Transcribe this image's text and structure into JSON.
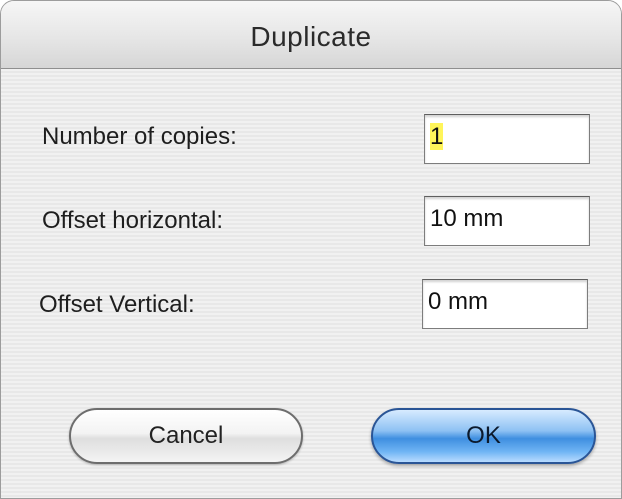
{
  "dialog": {
    "title": "Duplicate"
  },
  "fields": {
    "copies": {
      "label": "Number of copies:",
      "value": "1"
    },
    "offset_horizontal": {
      "label": "Offset horizontal:",
      "value": "10 mm"
    },
    "offset_vertical": {
      "label": "Offset Vertical:",
      "value": "0 mm"
    }
  },
  "buttons": {
    "cancel": "Cancel",
    "ok": "OK"
  },
  "colors": {
    "selection_highlight": "#fff55a",
    "default_button": "#3f8fe0"
  }
}
